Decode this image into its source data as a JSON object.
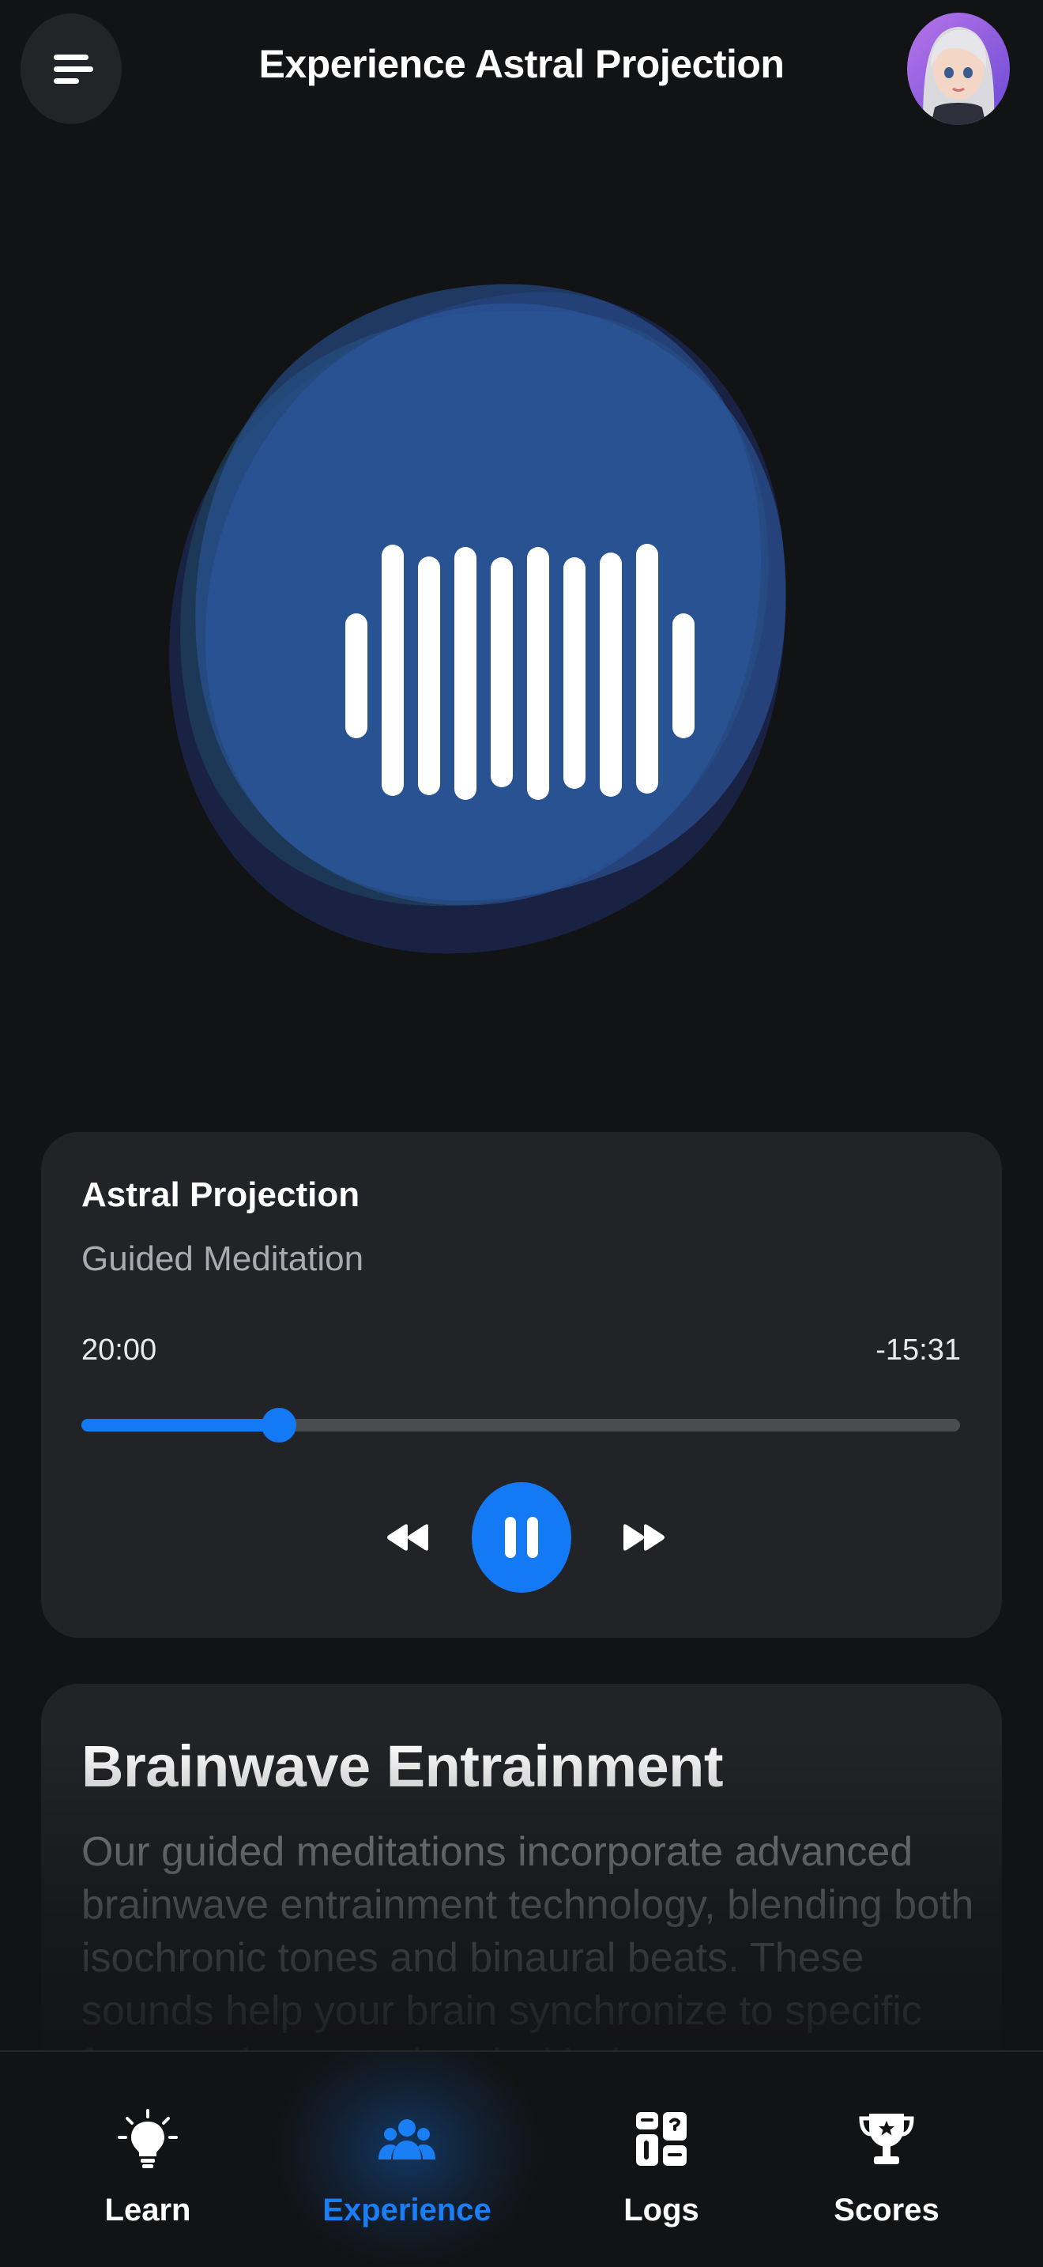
{
  "header": {
    "title": "Experience Astral Projection",
    "menu_icon": "menu-icon",
    "avatar_icon": "user-avatar"
  },
  "player": {
    "track_title": "Astral Projection",
    "track_subtitle": "Guided Meditation",
    "elapsed": "20:00",
    "remaining": "-15:31",
    "progress_fraction": 0.225,
    "accent_color": "#1379f5",
    "controls": [
      "rewind-icon",
      "pause-icon",
      "fast-forward-icon"
    ]
  },
  "info": {
    "heading": "Brainwave Entrainment",
    "body": "Our guided meditations incorporate advanced brainwave entrainment technology, blending both isochronic tones and binaural beats. These sounds help your brain synchronize to specific frequencies associated with deep"
  },
  "nav": {
    "items": [
      {
        "label": "Learn",
        "icon": "lightbulb-icon",
        "active": false
      },
      {
        "label": "Experience",
        "icon": "group-icon",
        "active": true
      },
      {
        "label": "Logs",
        "icon": "logs-icon",
        "active": false
      },
      {
        "label": "Scores",
        "icon": "trophy-icon",
        "active": false
      }
    ],
    "active_color": "#1a7ef5"
  }
}
